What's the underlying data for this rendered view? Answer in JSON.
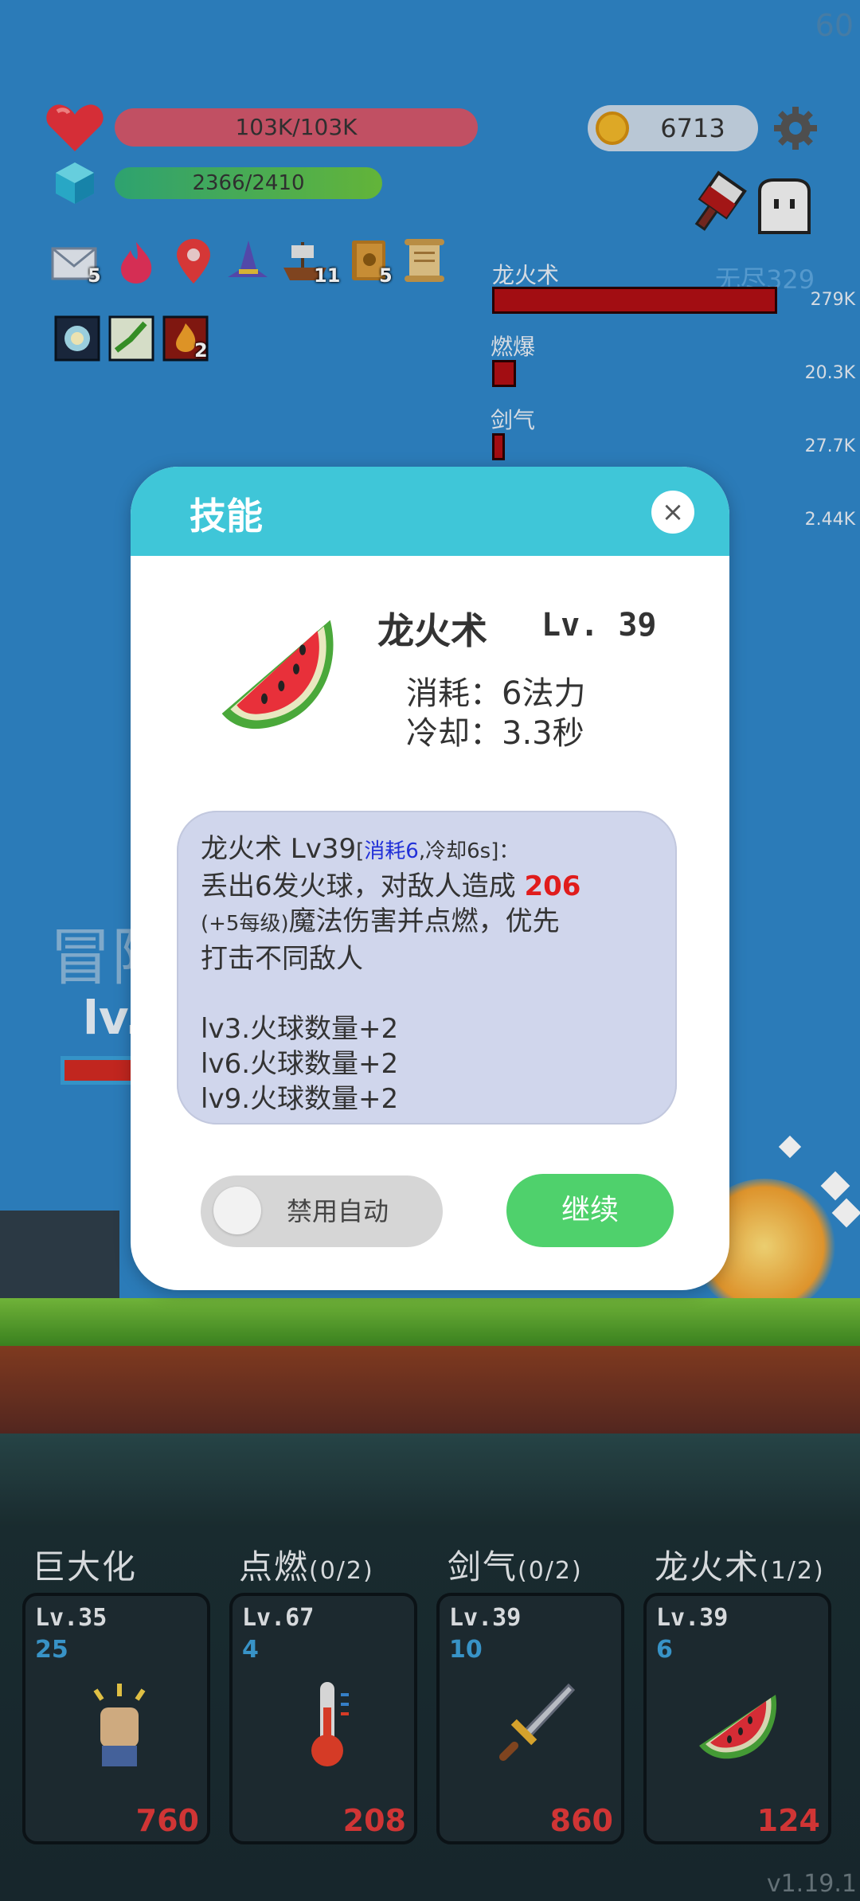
{
  "hud": {
    "fps": "60",
    "hp": "103K/103K",
    "mp": "2366/2410",
    "gold": "6713",
    "badges": {
      "mail": "5",
      "ship": "11",
      "book": "5",
      "fire_buff": "2"
    }
  },
  "boss": {
    "name": "龙火术",
    "stage": "无尽329",
    "rows": [
      {
        "label": "",
        "value": "279K"
      },
      {
        "label": "燃爆",
        "value": "20.3K"
      },
      {
        "label": "剑气",
        "value": "27.7K"
      },
      {
        "label": "",
        "value": "2.44K"
      }
    ]
  },
  "background_text": {
    "adventure": "冒险",
    "level": "lv."
  },
  "dialog": {
    "title": "技能",
    "close": "×",
    "skill_name": "龙火术",
    "skill_level": "Lv. 39",
    "cost_line": "消耗：6法力",
    "cd_line": "冷却：3.3秒",
    "desc_head": "龙火术 Lv39",
    "desc_bracket_open": "[",
    "desc_cost": "消耗6",
    "desc_cd": ",冷却6s]：",
    "desc_line1": "丢出6发火球，对敌人造成",
    "desc_damage": "206",
    "desc_scale": "(+5每级)",
    "desc_line2": "魔法伤害并点燃，优先",
    "desc_line3": "打击不同敌人",
    "upgrades": [
      "lv3.火球数量+2",
      "lv6.火球数量+2",
      "lv9.火球数量+2"
    ],
    "toggle_label": "禁用自动",
    "continue": "继续"
  },
  "skills": [
    {
      "name": "巨大化",
      "progress": "",
      "level": "Lv.35",
      "count": "25",
      "cost": "760",
      "icon": "fist-icon"
    },
    {
      "name": "点燃",
      "progress": "(0/2)",
      "level": "Lv.67",
      "count": "4",
      "cost": "208",
      "icon": "thermometer-icon"
    },
    {
      "name": "剑气",
      "progress": "(0/2)",
      "level": "Lv.39",
      "count": "10",
      "cost": "860",
      "icon": "sword-icon"
    },
    {
      "name": "龙火术",
      "progress": "(1/2)",
      "level": "Lv.39",
      "count": "6",
      "cost": "124",
      "icon": "watermelon-icon"
    }
  ],
  "version": "v1.19.1",
  "colors": {
    "background": "#2f86c8",
    "dialog_header": "#3fc6d8",
    "continue": "#4fd16c",
    "damage_red": "#e01c1c"
  }
}
